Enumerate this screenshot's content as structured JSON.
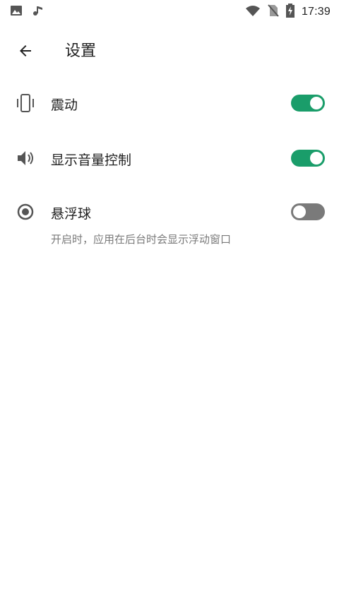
{
  "status_bar": {
    "time": "17:39",
    "icons": [
      "image-icon",
      "music-note-icon",
      "wifi-icon",
      "no-sim-icon",
      "battery-charging-icon"
    ]
  },
  "app_bar": {
    "back_icon": "arrow-back-icon",
    "title": "设置"
  },
  "settings": [
    {
      "icon": "phone-vibrate-icon",
      "label": "震动",
      "enabled": true
    },
    {
      "icon": "volume-icon",
      "label": "显示音量控制",
      "enabled": true
    },
    {
      "icon": "radio-button-icon",
      "label": "悬浮球",
      "description": "开启时，应用在后台时会显示浮动窗口",
      "enabled": false
    }
  ],
  "colors": {
    "switch_on": "#1a9d6a",
    "switch_off": "#7a7a7a",
    "text_primary": "#212121",
    "text_secondary": "#7a7a7a"
  }
}
